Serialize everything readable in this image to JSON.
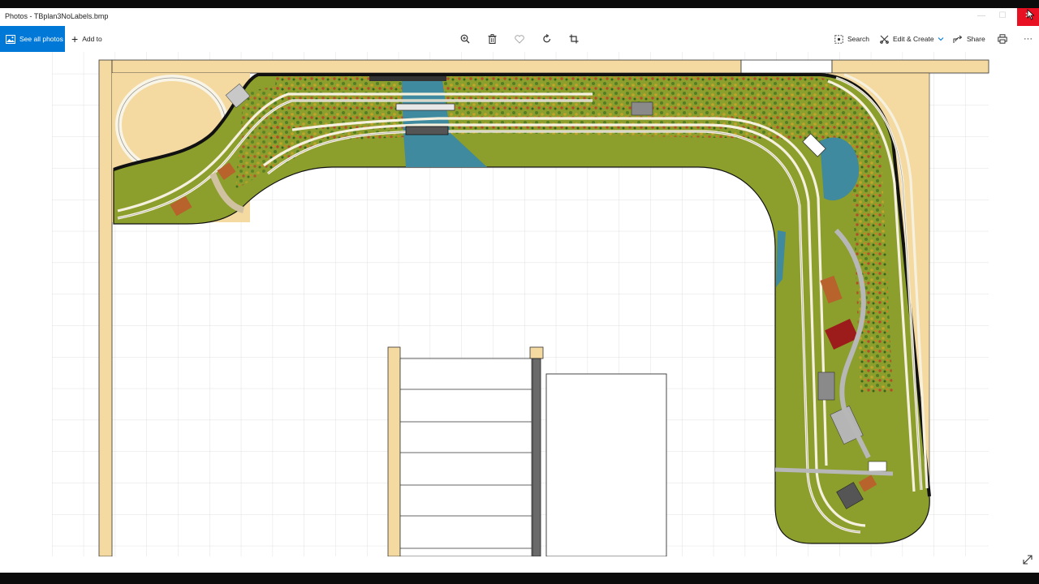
{
  "window": {
    "title": "Photos - TBplan3NoLabels.bmp",
    "min_glyph": "—",
    "max_glyph": "☐",
    "close_glyph": "✕"
  },
  "toolbar": {
    "see_all_photos": "See all photos",
    "add_to": "Add to",
    "search": "Search",
    "edit_create": "Edit & Create",
    "share": "Share",
    "more": "···",
    "icons": [
      "zoom-icon",
      "delete-icon",
      "favorite-icon",
      "rotate-icon",
      "crop-icon",
      "print-icon"
    ]
  },
  "colors": {
    "accent": "#0078d7",
    "close": "#e81123",
    "benchwork": "#f4d9a0",
    "scenery": "#8c9e2c",
    "water": "#3f8a9e",
    "track": "#f6f1df"
  }
}
